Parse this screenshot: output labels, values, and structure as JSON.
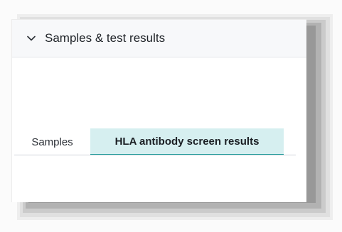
{
  "panel": {
    "title": "Samples & test results",
    "expanded": true,
    "chevron_icon": "chevron-down-icon"
  },
  "tabs": [
    {
      "label": "Samples",
      "active": false
    },
    {
      "label": "HLA antibody screen results",
      "active": true
    }
  ],
  "colors": {
    "active_tab_bg": "#d6eff0",
    "active_tab_accent": "#1a9a99",
    "header_bg": "#f7f8fa"
  }
}
